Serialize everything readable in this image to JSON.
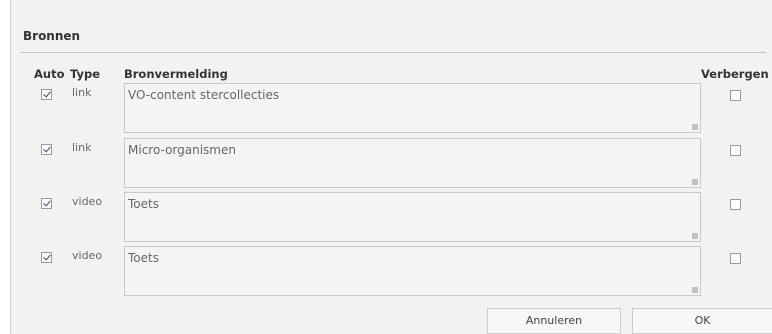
{
  "section": {
    "title": "Bronnen"
  },
  "columns": {
    "auto": "Auto",
    "type": "Type",
    "source": "Bronvermelding",
    "hide": "Verbergen"
  },
  "rows": [
    {
      "auto_checked": true,
      "type": "link",
      "source": "VO-content stercollecties",
      "hidden": false
    },
    {
      "auto_checked": true,
      "type": "link",
      "source": "Micro-organismen",
      "hidden": false
    },
    {
      "auto_checked": true,
      "type": "video",
      "source": "Toets",
      "hidden": false
    },
    {
      "auto_checked": true,
      "type": "video",
      "source": "Toets",
      "hidden": false
    }
  ],
  "buttons": {
    "cancel": "Annuleren",
    "ok": "OK"
  }
}
